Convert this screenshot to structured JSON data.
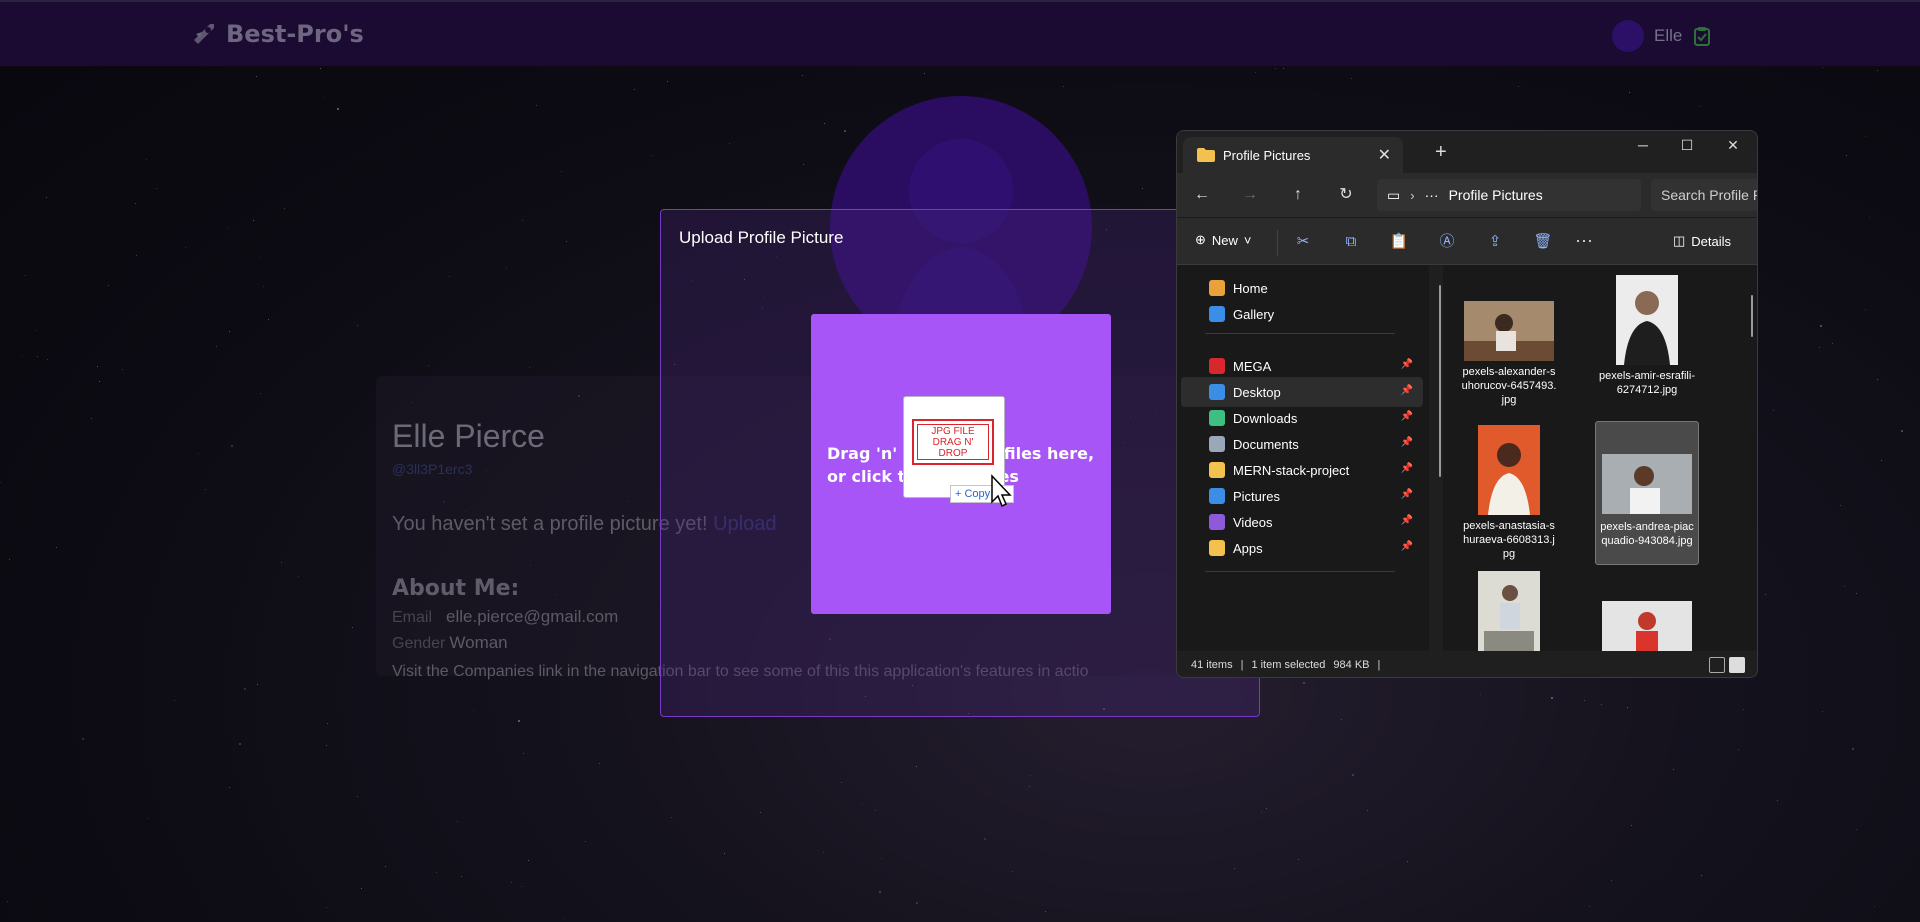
{
  "app": {
    "brand": "Best-Pro's",
    "user_name": "Elle"
  },
  "profile": {
    "name": "Elle Pierce",
    "handle": "@3ll3P1erc3",
    "no_picture_msg": "You haven't set a profile picture yet!",
    "upload_link": "Upload",
    "about_title": "About Me:",
    "email_label": "Email",
    "email_value": "elle.pierce@gmail.com",
    "gender_label": "Gender",
    "gender_value": "Woman",
    "visit_text": "Visit the Companies link in the navigation bar to see some of this this application's features in actio"
  },
  "modal": {
    "title": "Upload Profile Picture",
    "dropzone_text": "Drag 'n' drop some files here, or click to select files"
  },
  "drag": {
    "thumb_text": "JPG FILE DRAG N' DROP",
    "copy_tip": "+ Copy"
  },
  "explorer": {
    "tab_title": "Profile Pictures",
    "address": "Profile Pictures",
    "search_placeholder": "Search Profile P",
    "new_label": "New",
    "details_label": "Details",
    "nav_items": [
      {
        "label": "Home",
        "icon": "home-icon",
        "color": "#e9a23b",
        "pinned": false,
        "selected": false
      },
      {
        "label": "Gallery",
        "icon": "gallery-icon",
        "color": "#3a8ee6",
        "pinned": false,
        "selected": false
      },
      {
        "label": "MEGA",
        "icon": "mega-icon",
        "color": "#d9272e",
        "pinned": true,
        "selected": false
      },
      {
        "label": "Desktop",
        "icon": "desktop-icon",
        "color": "#3a8ee6",
        "pinned": true,
        "selected": true
      },
      {
        "label": "Downloads",
        "icon": "download-icon",
        "color": "#3fbf7f",
        "pinned": true,
        "selected": false
      },
      {
        "label": "Documents",
        "icon": "documents-icon",
        "color": "#9aa7b8",
        "pinned": true,
        "selected": false
      },
      {
        "label": "MERN-stack-project",
        "icon": "folder-icon",
        "color": "#f2c14e",
        "pinned": true,
        "selected": false
      },
      {
        "label": "Pictures",
        "icon": "pictures-icon",
        "color": "#3a8ee6",
        "pinned": true,
        "selected": false
      },
      {
        "label": "Videos",
        "icon": "videos-icon",
        "color": "#8f5ad9",
        "pinned": true,
        "selected": false
      },
      {
        "label": "Apps",
        "icon": "folder-icon",
        "color": "#f2c14e",
        "pinned": true,
        "selected": false
      }
    ],
    "files": [
      {
        "name": "pexels-alexander-suhorucov-6457493.jpg",
        "selected": false
      },
      {
        "name": "pexels-amir-esrafili-6274712.jpg",
        "selected": false
      },
      {
        "name": "pexels-anastasia-shuraeva-6608313.jpg",
        "selected": false
      },
      {
        "name": "pexels-andrea-piacquadio-943084.jpg",
        "selected": true
      }
    ],
    "status_count": "41 items",
    "status_selected": "1 item selected",
    "status_size": "984 KB"
  }
}
